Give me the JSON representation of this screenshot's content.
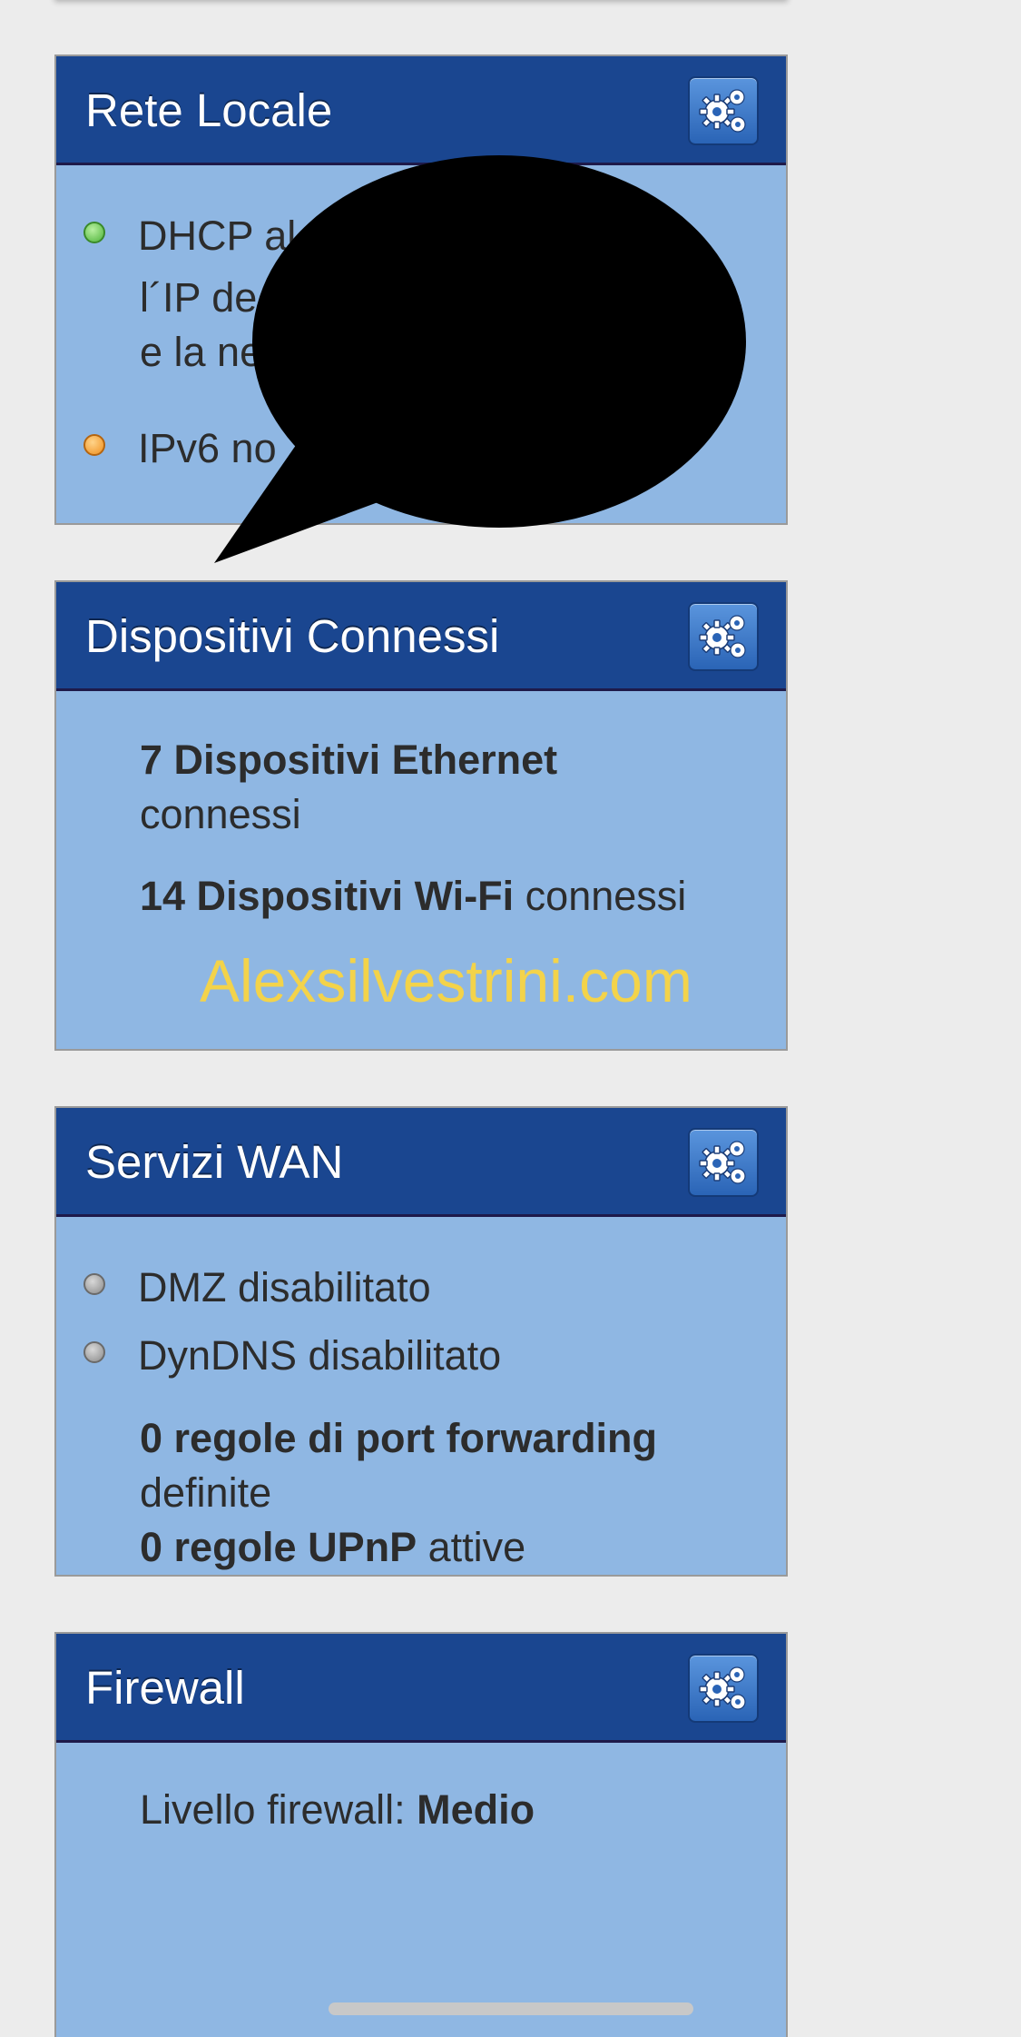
{
  "lan": {
    "title": "Rete Locale",
    "dhcp_text": "DHCP al",
    "ip_line": "l´IP de",
    "net_line": "e la ne",
    "ipv6_text": "IPv6 no"
  },
  "devices": {
    "title": "Dispositivi Connessi",
    "ethernet_bold": "7 Dispositivi Ethernet",
    "ethernet_rest": "connessi",
    "wifi_bold": "14 Dispositivi Wi-Fi",
    "wifi_rest": " connessi",
    "watermark": "Alexsilvestrini.com"
  },
  "wan": {
    "title": "Servizi WAN",
    "dmz": "DMZ disabilitato",
    "dyndns": "DynDNS disabilitato",
    "port_forwarding_bold": "0 regole di port forwarding",
    "port_forwarding_rest": "definite",
    "upnp_bold": "0 regole UPnP",
    "upnp_rest": " attive"
  },
  "firewall": {
    "title": "Firewall",
    "level_label": "Livello firewall: ",
    "level_value": "Medio"
  },
  "icons": {
    "settings": "gears-icon",
    "status_on": "green-led-icon",
    "status_warn": "orange-led-icon",
    "status_off": "grey-led-icon"
  },
  "colors": {
    "header": "#1a4690",
    "panel": "#8fb7e3",
    "watermark": "#f3d34a",
    "redaction": "#000000"
  }
}
